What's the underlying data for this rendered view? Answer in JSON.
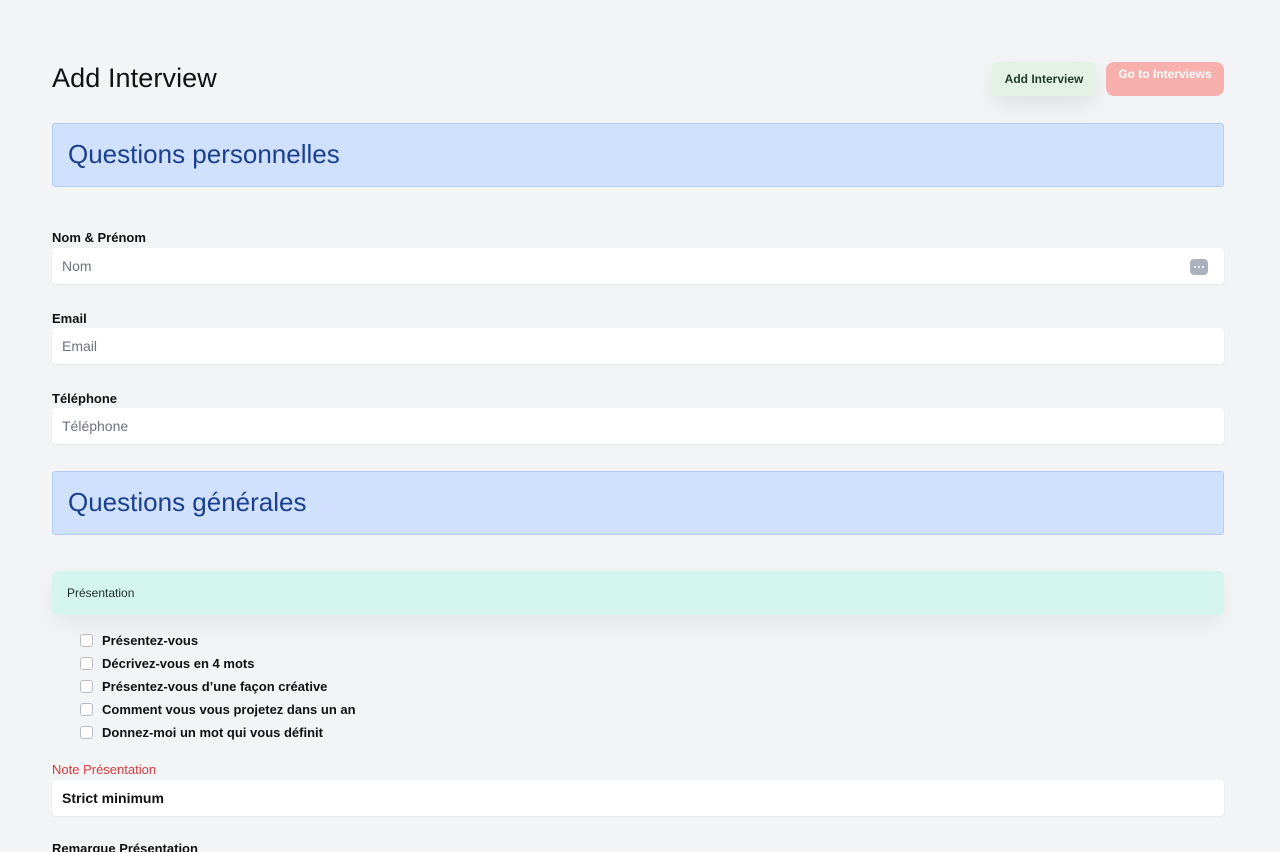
{
  "header": {
    "title": "Add Interview",
    "add_button": "Add Interview",
    "go_button": "Go to Interviews"
  },
  "personal_section": {
    "title": "Questions personnelles",
    "fields": {
      "name": {
        "label": "Nom & Prénom",
        "placeholder": "Nom"
      },
      "email": {
        "label": "Email",
        "placeholder": "Email"
      },
      "phone": {
        "label": "Téléphone",
        "placeholder": "Téléphone"
      }
    }
  },
  "general_section": {
    "title": "Questions générales",
    "topic": {
      "title": "Présentation",
      "questions": [
        "Présentez-vous",
        "Décrivez-vous en 4 mots",
        "Présentez-vous d’une façon créative",
        "Comment vous vous projetez dans un an",
        "Donnez-moi un mot qui vous définit"
      ],
      "note_label": "Note Présentation",
      "note_value": "Strict minimum",
      "remark_label": "Remarque Présentation"
    }
  },
  "colors": {
    "section_banner": "#cfe1fd",
    "section_title": "#1c3f8f",
    "topic_card": "#d4f4ee",
    "add_button_bg": "#e3f2e5",
    "go_button_bg": "#f8b0ad",
    "note_label": "#d73a3a"
  },
  "icons": {
    "name_field_addon": "more-dots-icon"
  }
}
